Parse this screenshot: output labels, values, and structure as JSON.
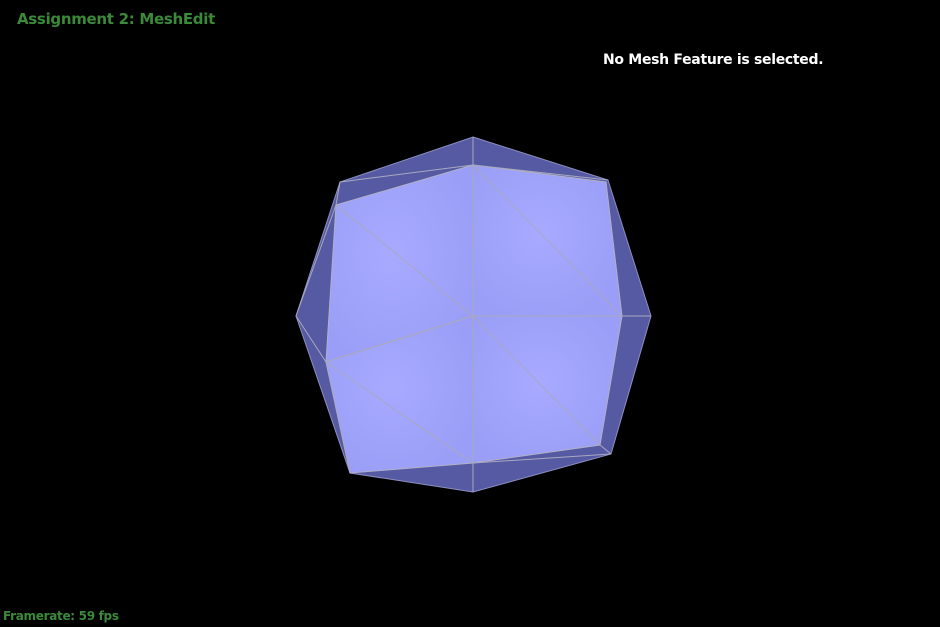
{
  "window": {
    "title": "Assignment 2: MeshEdit"
  },
  "status": {
    "selection_text": "No Mesh Feature is selected."
  },
  "footer": {
    "framerate_text": "Framerate: 59 fps"
  },
  "colors": {
    "background": "#000000",
    "title_text": "#3a8a3a",
    "status_text": "#ffffff",
    "front_face": "#a3a6fb",
    "side_face": "#565aa3",
    "wire": "#b8b8d0"
  }
}
